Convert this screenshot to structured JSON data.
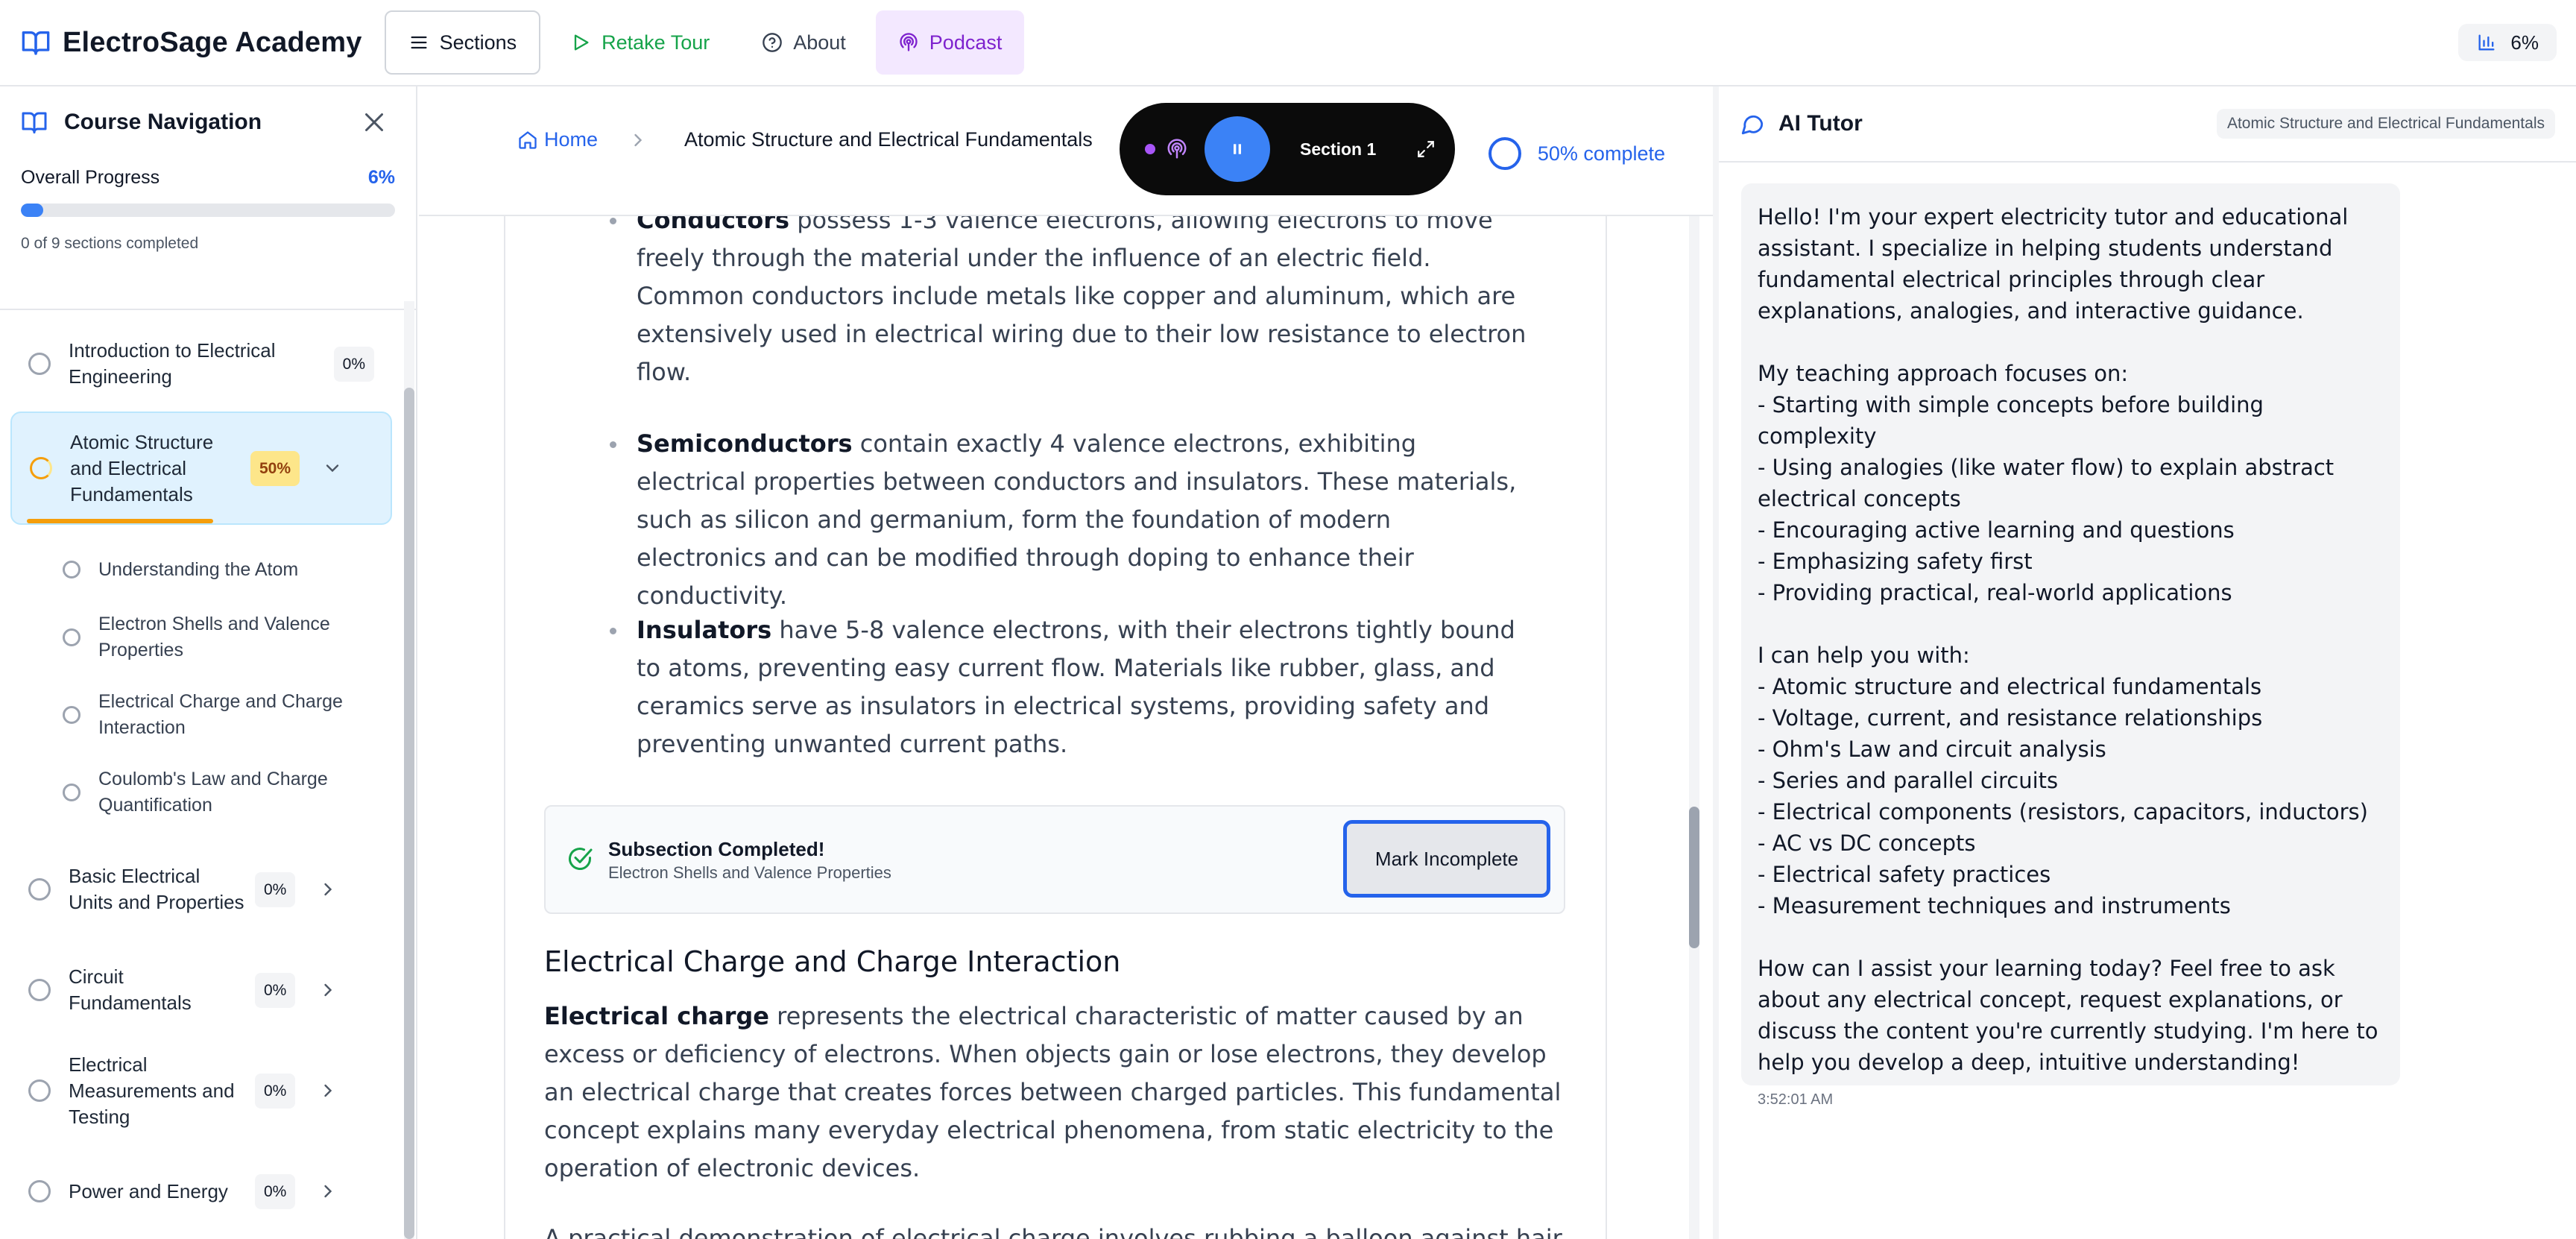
{
  "app": {
    "title": "ElectroSage Academy"
  },
  "header": {
    "sections_label": "Sections",
    "retake_label": "Retake Tour",
    "about_label": "About",
    "podcast_label": "Podcast",
    "overall_pct": "6%"
  },
  "colors": {
    "accent": "#2563eb",
    "success": "#16a34a",
    "podcast": "#7e22ce",
    "warning": "#f59e0b"
  },
  "sidebar": {
    "title": "Course Navigation",
    "progress_label": "Overall Progress",
    "progress_pct": "6%",
    "progress_value": 0.06,
    "progress_sub": "0 of 9 sections completed",
    "sections": [
      {
        "label": "Introduction to Electrical Engineering",
        "pct": "0%"
      },
      {
        "label": "Atomic Structure and Electrical Fundamentals",
        "pct": "50%",
        "progress_value": 0.5
      },
      {
        "label": "Basic Electrical Units and Properties",
        "pct": "0%"
      },
      {
        "label": "Circuit Fundamentals",
        "pct": "0%"
      },
      {
        "label": "Electrical Measurements and Testing",
        "pct": "0%"
      },
      {
        "label": "Power and Energy",
        "pct": "0%"
      }
    ],
    "subsections": [
      "Understanding the Atom",
      "Electron Shells and Valence Properties",
      "Electrical Charge and Charge Interaction",
      "Coulomb's Law and Charge Quantification"
    ]
  },
  "breadcrumb": {
    "home": "Home",
    "current": "Atomic Structure and Electrical Fundamentals"
  },
  "progress": {
    "complete_label": "50% complete"
  },
  "player": {
    "section_label": "Section 1"
  },
  "content": {
    "b1_term": "Conductors",
    "b1_text": " possess 1-3 valence electrons, allowing electrons to move freely through the material under the influence of an electric field. Common conductors include metals like copper and aluminum, which are extensively used in electrical wiring due to their low resistance to electron flow.",
    "b2_term": "Semiconductors",
    "b2_text": " contain exactly 4 valence electrons, exhibiting electrical properties between conductors and insulators. These materials, such as silicon and germanium, form the foundation of modern electronics and can be modified through doping to enhance their conductivity.",
    "b3_term": "Insulators",
    "b3_text": " have 5-8 valence electrons, with their electrons tightly bound to atoms, preventing easy current flow. Materials like rubber, glass, and ceramics serve as insulators in electrical systems, providing safety and preventing unwanted current paths.",
    "done_title": "Subsection Completed!",
    "done_sub": "Electron Shells and Valence Properties",
    "mark_btn": "Mark Incomplete",
    "heading": "Electrical Charge and Charge Interaction",
    "p1_term": "Electrical charge",
    "p1_text": " represents the electrical characteristic of matter caused by an excess or deficiency of electrons. When objects gain or lose electrons, they develop an electrical charge that creates forces between charged particles. This fundamental concept explains many everyday electrical phenomena, from static electricity to the operation of electronic devices.",
    "p2_text": "A practical demonstration of electrical charge involves rubbing a balloon against hair,"
  },
  "tutor": {
    "title": "AI Tutor",
    "context": "Atomic Structure and Electrical Fundamentals",
    "message": "Hello! I'm your expert electricity tutor and educational assistant. I specialize in helping students understand fundamental electrical principles through clear explanations, analogies, and interactive guidance.\n\nMy teaching approach focuses on:\n- Starting with simple concepts before building complexity\n- Using analogies (like water flow) to explain abstract electrical concepts\n- Encouraging active learning and questions\n- Emphasizing safety first\n- Providing practical, real-world applications\n\nI can help you with:\n- Atomic structure and electrical fundamentals\n- Voltage, current, and resistance relationships\n- Ohm's Law and circuit analysis\n- Series and parallel circuits\n- Electrical components (resistors, capacitors, inductors)\n- AC vs DC concepts\n- Electrical safety practices\n- Measurement techniques and instruments\n\nHow can I assist your learning today? Feel free to ask about any electrical concept, request explanations, or discuss the content you're currently studying. I'm here to help you develop a deep, intuitive understanding!",
    "time": "3:52:01 AM"
  }
}
